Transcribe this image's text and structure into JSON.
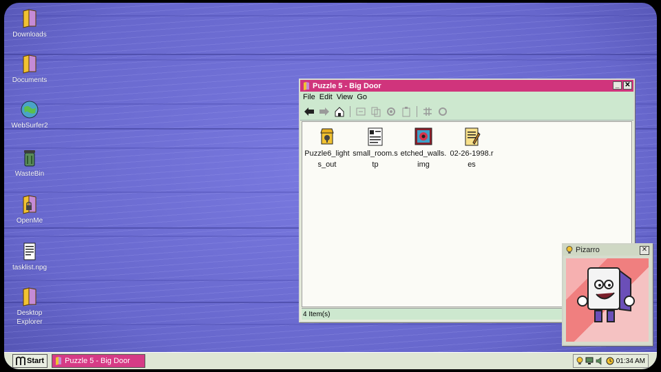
{
  "desktop": {
    "icons": [
      {
        "label": "Downloads",
        "icon": "folder-icon"
      },
      {
        "label": "Documents",
        "icon": "folder-icon"
      },
      {
        "label": "WebSurfer2",
        "icon": "globe-icon"
      },
      {
        "label": "WasteBin",
        "icon": "trash-icon"
      },
      {
        "label": "OpenMe",
        "icon": "folder-lock-icon"
      },
      {
        "label": "tasklist.npg",
        "icon": "notepad-icon"
      },
      {
        "label": "Desktop Explorer",
        "icon": "folder-icon"
      }
    ]
  },
  "window": {
    "title": "Puzzle 5 - Big Door",
    "menu": [
      "File",
      "Edit",
      "View",
      "Go"
    ],
    "toolbar": [
      "back-arrow-icon",
      "forward-arrow-icon",
      "up-folder-icon",
      "cut-icon",
      "copy-icon",
      "settings-icon",
      "paste-icon",
      "properties-icon",
      "refresh-icon"
    ],
    "files": [
      {
        "name": "Puzzle6_lights_out",
        "icon": "locked-file-icon"
      },
      {
        "name": "small_room.stp",
        "icon": "document-icon"
      },
      {
        "name": "etched_walls.img",
        "icon": "image-icon"
      },
      {
        "name": "02-26-1998.res",
        "icon": "notepad-icon"
      }
    ],
    "status": "4 Item(s)",
    "minimize": "_",
    "close": "✕"
  },
  "assistant": {
    "title": "Pizarro",
    "close": "✕"
  },
  "taskbar": {
    "start_label": "Start",
    "task_label": "Puzzle 5 - Big Door",
    "clock": "01:34 AM"
  }
}
